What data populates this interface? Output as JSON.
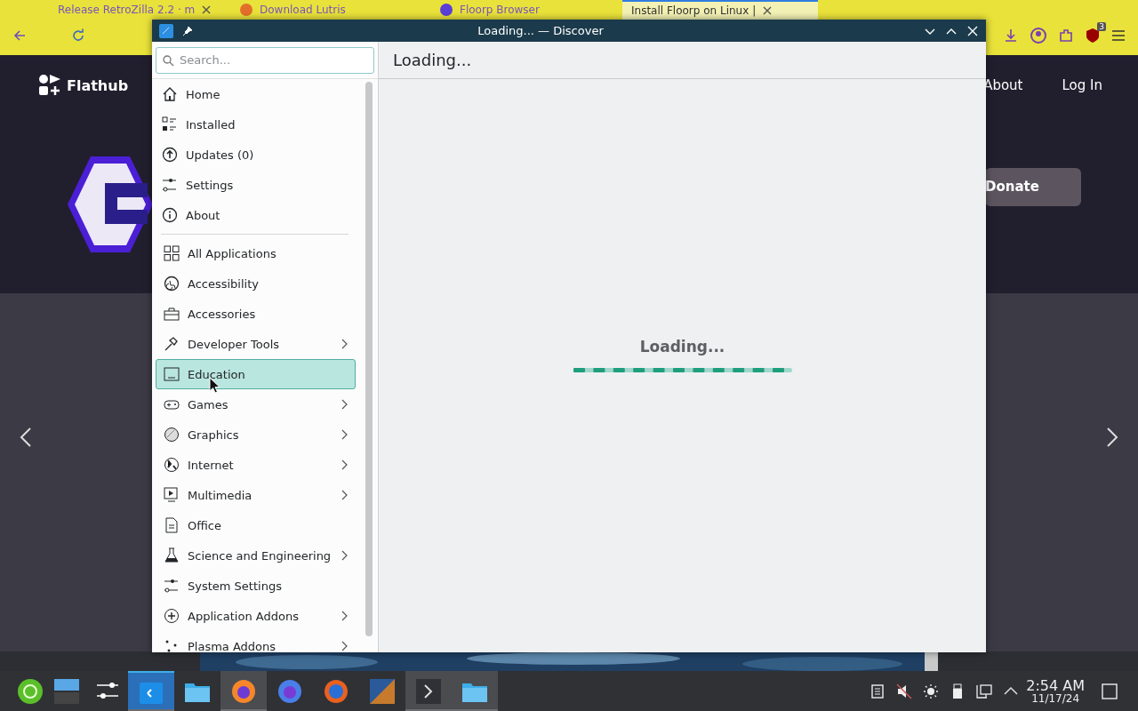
{
  "browser": {
    "tabs": [
      {
        "label": "Release RetroZilla 2.2 · m",
        "selected": false,
        "closable": true
      },
      {
        "label": "Download Lutris",
        "selected": false,
        "closable": false
      },
      {
        "label": "Floorp Browser",
        "selected": false,
        "closable": false
      },
      {
        "label": "Install Floorp on Linux |",
        "selected": true,
        "closable": true
      }
    ],
    "extension_badge": "3",
    "page": {
      "brand": "Flathub",
      "nav": [
        "About",
        "Log In"
      ],
      "donate": "Donate"
    }
  },
  "discover": {
    "title": "Loading... — Discover",
    "search": {
      "placeholder": "Search..."
    },
    "header": "Loading...",
    "nav": [
      {
        "label": "Home",
        "selected": false,
        "expandable": false
      },
      {
        "label": "Installed",
        "selected": false,
        "expandable": false
      },
      {
        "label": "Updates (0)",
        "selected": false,
        "expandable": false
      },
      {
        "label": "Settings",
        "selected": false,
        "expandable": false
      },
      {
        "label": "About",
        "selected": false,
        "expandable": false
      }
    ],
    "categories": [
      {
        "label": "All Applications",
        "selected": false,
        "expandable": false
      },
      {
        "label": "Accessibility",
        "selected": false,
        "expandable": false
      },
      {
        "label": "Accessories",
        "selected": false,
        "expandable": false
      },
      {
        "label": "Developer Tools",
        "selected": false,
        "expandable": true
      },
      {
        "label": "Education",
        "selected": true,
        "expandable": false
      },
      {
        "label": "Games",
        "selected": false,
        "expandable": true
      },
      {
        "label": "Graphics",
        "selected": false,
        "expandable": true
      },
      {
        "label": "Internet",
        "selected": false,
        "expandable": true
      },
      {
        "label": "Multimedia",
        "selected": false,
        "expandable": true
      },
      {
        "label": "Office",
        "selected": false,
        "expandable": false
      },
      {
        "label": "Science and Engineering",
        "selected": false,
        "expandable": true
      },
      {
        "label": "System Settings",
        "selected": false,
        "expandable": false
      },
      {
        "label": "Application Addons",
        "selected": false,
        "expandable": true
      },
      {
        "label": "Plasma Addons",
        "selected": false,
        "expandable": true
      }
    ],
    "status": "Loading..."
  },
  "taskbar": {
    "apps": [
      {
        "selected": false,
        "open": false
      },
      {
        "selected": false,
        "open": false
      },
      {
        "selected": false,
        "open": false
      },
      {
        "selected": true,
        "open": true
      },
      {
        "selected": false,
        "open": false
      },
      {
        "selected": false,
        "open": true
      },
      {
        "selected": false,
        "open": false
      },
      {
        "selected": false,
        "open": false
      },
      {
        "selected": false,
        "open": false
      },
      {
        "selected": false,
        "open": true
      },
      {
        "selected": false,
        "open": true
      }
    ],
    "clock": {
      "time": "2:54 AM",
      "date": "11/17/24"
    }
  }
}
